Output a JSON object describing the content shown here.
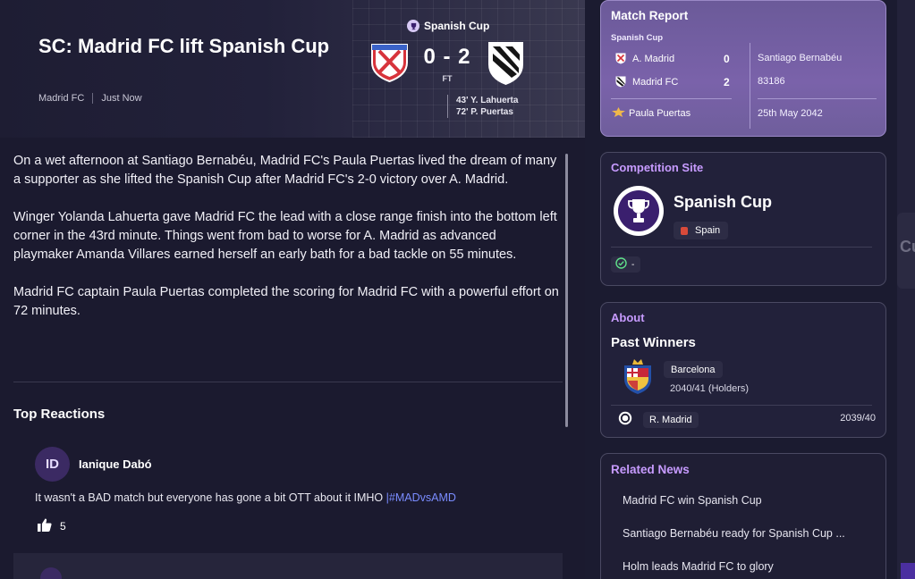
{
  "article": {
    "title": "SC: Madrid FC lift Spanish Cup",
    "source": "Madrid FC",
    "time": "Just Now",
    "paragraphs": [
      "On a wet afternoon at Santiago Bernabéu, Madrid FC's Paula Puertas lived the dream of many a supporter as she lifted the Spanish Cup after Madrid FC's 2-0 victory over A. Madrid.",
      "Winger Yolanda Lahuerta gave Madrid FC the lead with a close range finish into the bottom left corner in the 43rd minute. Things went from bad to worse for A. Madrid as advanced playmaker Amanda Villares earned herself an early bath for a bad tackle on 55 minutes.",
      "Madrid FC captain Paula Puertas completed the scoring for Madrid FC with a powerful effort on 72 minutes."
    ]
  },
  "match": {
    "competition": "Spanish Cup",
    "score": "0 - 2",
    "status": "FT",
    "scorers": [
      "43' Y. Lahuerta",
      "72' P. Puertas"
    ]
  },
  "reactions": {
    "title": "Top Reactions",
    "items": [
      {
        "initials": "ID",
        "name": "Ianique Dabó",
        "text": "It wasn't a BAD match but everyone has gone a bit OTT about it IMHO ",
        "hashtag": "|#MADvsAMD",
        "likes": "5"
      }
    ]
  },
  "report": {
    "title": "Match Report",
    "competition": "Spanish Cup",
    "home": {
      "name": "A. Madrid",
      "score": "0"
    },
    "away": {
      "name": "Madrid FC",
      "score": "2"
    },
    "stadium": "Santiago Bernabéu",
    "attendance": "83186",
    "player_of_match": "Paula Puertas",
    "date": "25th May 2042"
  },
  "competition_site": {
    "title": "Competition Site",
    "name": "Spanish Cup",
    "country": "Spain",
    "status": "-"
  },
  "about": {
    "title": "About",
    "section": "Past Winners",
    "winner": {
      "name": "Barcelona",
      "season": "2040/41 (Holders)"
    },
    "previous": {
      "name": "R. Madrid",
      "season": "2039/40"
    }
  },
  "related": {
    "title": "Related News",
    "items": [
      "Madrid FC win Spanish Cup",
      "Santiago Bernabéu ready for Spanish Cup ...",
      "Holm leads Madrid FC to glory"
    ]
  },
  "edge": {
    "fragment": "Cu"
  },
  "colors": {
    "accent": "#c79bff",
    "report_bg": "#7a62aa",
    "hashtag": "#7a8cff",
    "background": "#1b1a2f"
  }
}
